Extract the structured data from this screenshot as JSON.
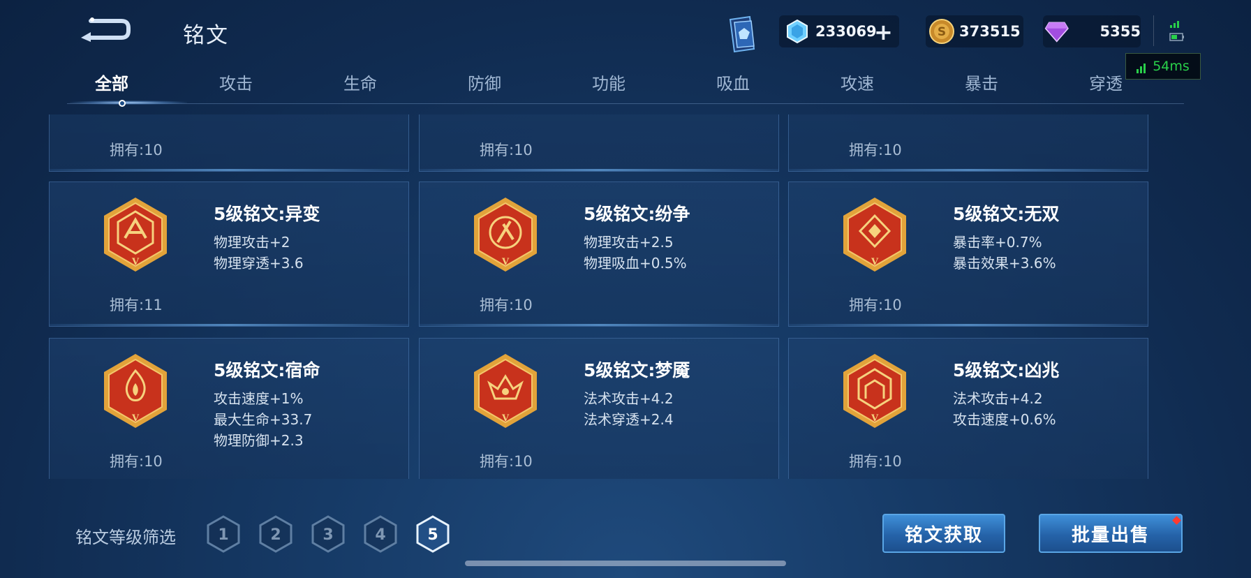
{
  "header": {
    "title": "铭文",
    "resources": {
      "diamond_value": "233069",
      "gold_value": "373515",
      "gem_value": "5355"
    },
    "ping": "54ms"
  },
  "tabs": [
    "全部",
    "攻击",
    "生命",
    "防御",
    "功能",
    "吸血",
    "攻速",
    "暴击",
    "穿透"
  ],
  "active_tab": 0,
  "top_row_owned": [
    "拥有:10",
    "拥有:10",
    "拥有:10"
  ],
  "inscriptions": [
    {
      "name": "5级铭文:异变",
      "attrs": [
        "物理攻击+2",
        "物理穿透+3.6"
      ],
      "owned": "拥有:11"
    },
    {
      "name": "5级铭文:纷争",
      "attrs": [
        "物理攻击+2.5",
        "物理吸血+0.5%"
      ],
      "owned": "拥有:10"
    },
    {
      "name": "5级铭文:无双",
      "attrs": [
        "暴击率+0.7%",
        "暴击效果+3.6%"
      ],
      "owned": "拥有:10"
    },
    {
      "name": "5级铭文:宿命",
      "attrs": [
        "攻击速度+1%",
        "最大生命+33.7",
        "物理防御+2.3"
      ],
      "owned": "拥有:10"
    },
    {
      "name": "5级铭文:梦魇",
      "attrs": [
        "法术攻击+4.2",
        "法术穿透+2.4"
      ],
      "owned": "拥有:10"
    },
    {
      "name": "5级铭文:凶兆",
      "attrs": [
        "法术攻击+4.2",
        "攻击速度+0.6%"
      ],
      "owned": "拥有:10"
    }
  ],
  "badge_mark": "V",
  "footer": {
    "filter_label": "铭文等级筛选",
    "levels": [
      "1",
      "2",
      "3",
      "4",
      "5"
    ],
    "selected_level": "5",
    "get_button": "铭文获取",
    "sell_button": "批量出售"
  },
  "colors": {
    "accent": "#3f8fd8",
    "badge_red": "#c8321c",
    "badge_gold": "#e2a33a",
    "ping_green": "#29d04a"
  }
}
